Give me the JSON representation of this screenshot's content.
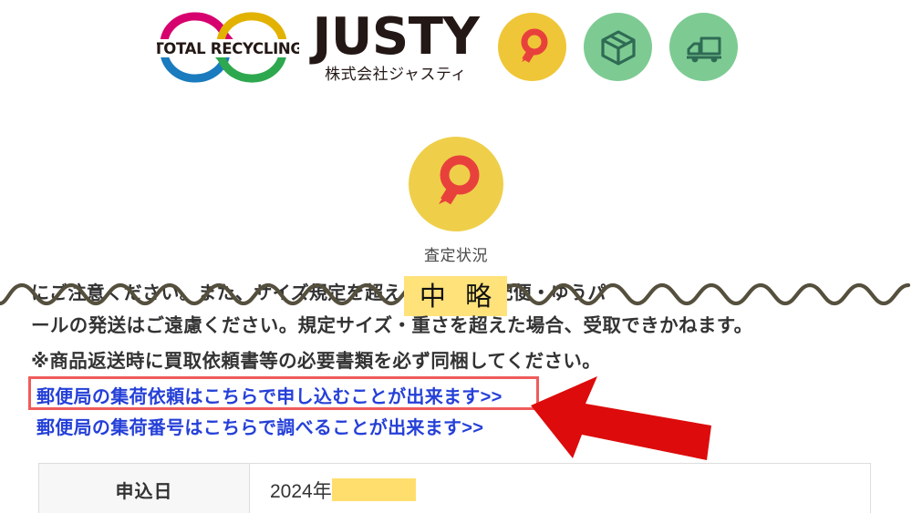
{
  "header": {
    "logo": {
      "tagline": "TOTAL RECYCLING",
      "arc_colors": [
        "#D6006E",
        "#E2B200",
        "#1A7BBE",
        "#2EA84F"
      ],
      "recycle_icon": "recycling-arrows-icon"
    },
    "brand": {
      "name": "JUSTY",
      "subtitle": "株式会社ジャスティ",
      "color": "#231815"
    },
    "icons": [
      {
        "name": "magnifier-icon",
        "bg": "#EFC637",
        "fg": "#E8413C",
        "label": "査定"
      },
      {
        "name": "package-box-icon",
        "bg": "#7DCB93",
        "fg": "#2F6B54",
        "label": "梱包"
      },
      {
        "name": "delivery-truck-icon",
        "bg": "#7DCB93",
        "fg": "#2F6B54",
        "label": "配送"
      }
    ]
  },
  "status": {
    "icon": "magnifier-icon",
    "circle_color": "#EFCF4A",
    "icon_color": "#E8413C",
    "caption": "査定状況"
  },
  "omission": {
    "label": "中 略",
    "highlight_color": "#FFE27A",
    "wave_color": "#554F3D"
  },
  "notes": {
    "clipped_line": "にご注意ください。また、サイズ規定を超える商品の宅配便・ゆうパ",
    "line1": "ールの発送はご遠慮ください。規定サイズ・重さを超えた場合、受取できかねます。",
    "line2": "※商品返送時に買取依頼書等の必要書類を必ず同梱してください。"
  },
  "links": [
    {
      "text": "郵便局の集荷依頼はこちらで申し込むことが出来ます>>",
      "highlighted": true
    },
    {
      "text": "郵便局の集荷番号はこちらで調べることが出来ます>>",
      "highlighted": false
    }
  ],
  "annotations": {
    "arrow": {
      "name": "red-arrow-pointer",
      "color": "#DD0B0B",
      "direction": "left"
    },
    "box": {
      "name": "red-highlight-box",
      "color": "#F05B5B"
    }
  },
  "table": {
    "rows": [
      {
        "label": "申込日",
        "value": "2024年",
        "redacted": true
      }
    ]
  },
  "colors": {
    "link": "#2540D8",
    "text": "#333333",
    "redaction": "#FFDE6E",
    "table_border": "#dddddd",
    "table_head_bg": "#f7f7f7"
  }
}
